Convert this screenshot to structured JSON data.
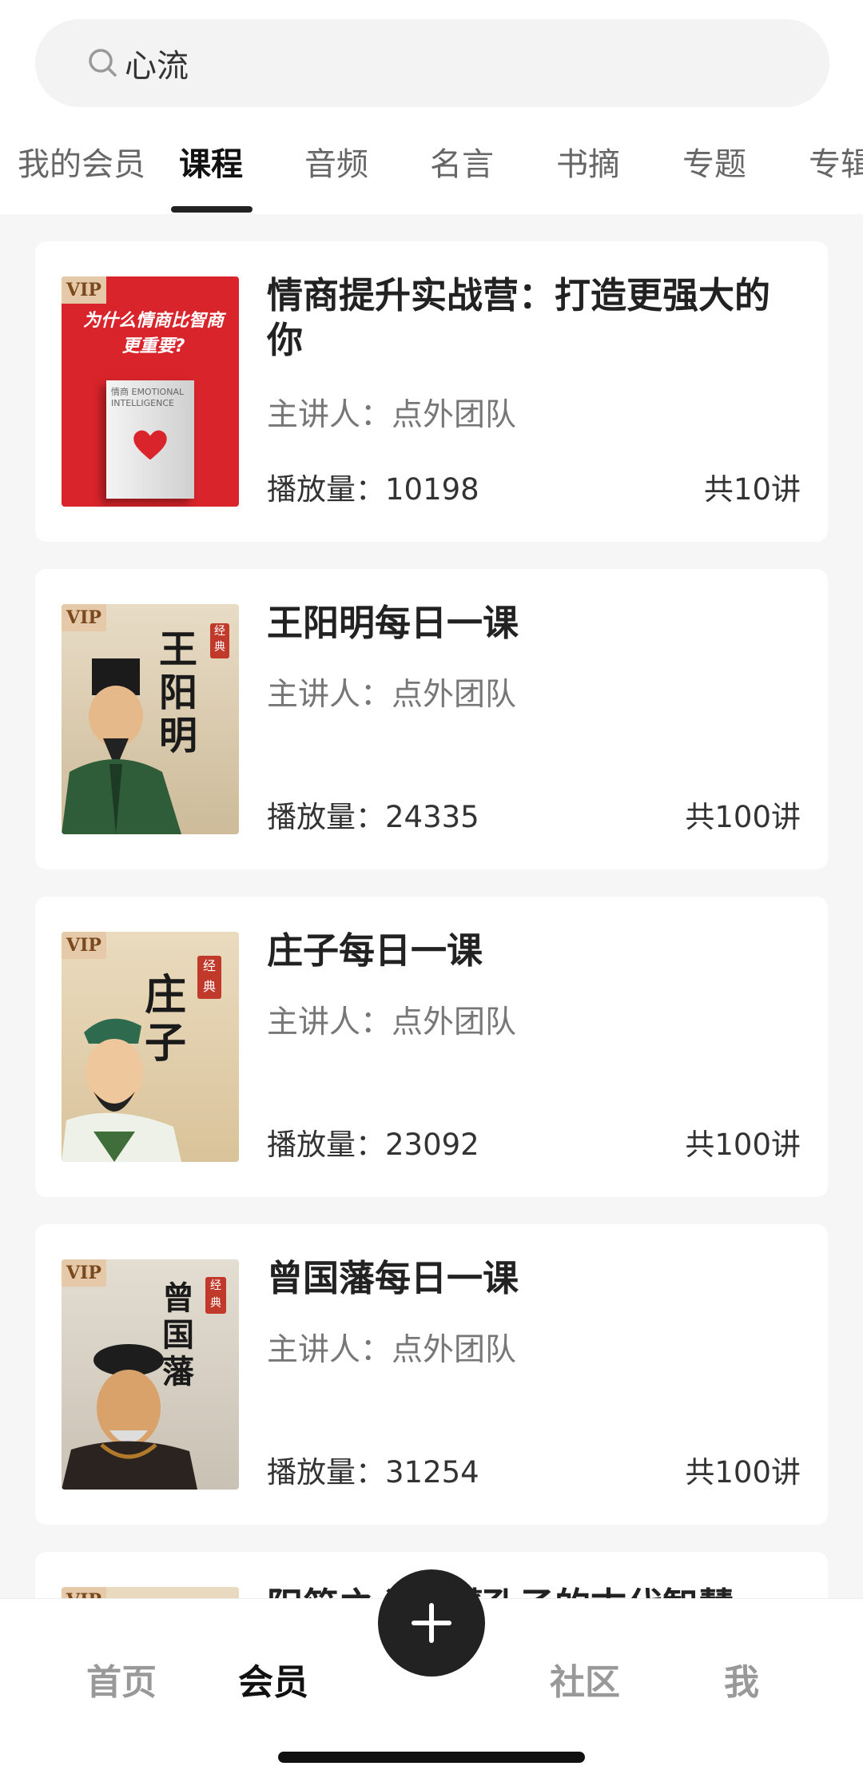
{
  "search": {
    "value": "心流",
    "placeholder": ""
  },
  "tabs": [
    {
      "label": "我的会员"
    },
    {
      "label": "课程"
    },
    {
      "label": "音频"
    },
    {
      "label": "名言"
    },
    {
      "label": "书摘"
    },
    {
      "label": "专题"
    },
    {
      "label": "专辑"
    }
  ],
  "courses": [
    {
      "badge": "VIP",
      "title": "情商提升实战营：打造更强大的你",
      "speaker": "主讲人：点外团队",
      "plays": "播放量：10198",
      "count": "共10讲",
      "cover_text": "为什么情商比智商更重要?",
      "cover_book": "情商 EMOTIONAL INTELLIGENCE"
    },
    {
      "badge": "VIP",
      "title": "王阳明每日一课",
      "speaker": "主讲人：点外团队",
      "plays": "播放量：24335",
      "count": "共100讲",
      "cover_text": "王阳明",
      "cover_seal": "经典"
    },
    {
      "badge": "VIP",
      "title": "庄子每日一课",
      "speaker": "主讲人：点外团队",
      "plays": "播放量：23092",
      "count": "共100讲",
      "cover_text": "庄子",
      "cover_seal": "经典"
    },
    {
      "badge": "VIP",
      "title": "曾国藩每日一课",
      "speaker": "主讲人：点外团队",
      "plays": "播放量：31254",
      "count": "共100讲",
      "cover_text": "曾国藩",
      "cover_seal": "经典"
    },
    {
      "badge": "VIP",
      "title": "阳简之心读懂孔子的古代智慧"
    }
  ],
  "nav": {
    "home": "首页",
    "member": "会员",
    "community": "社区",
    "me": "我"
  },
  "colors": {
    "accent": "#222222",
    "vip_badge": "#e5c9a8",
    "cover_red": "#d8242a"
  },
  "icons": {
    "search": "search-icon",
    "add": "plus-icon"
  }
}
